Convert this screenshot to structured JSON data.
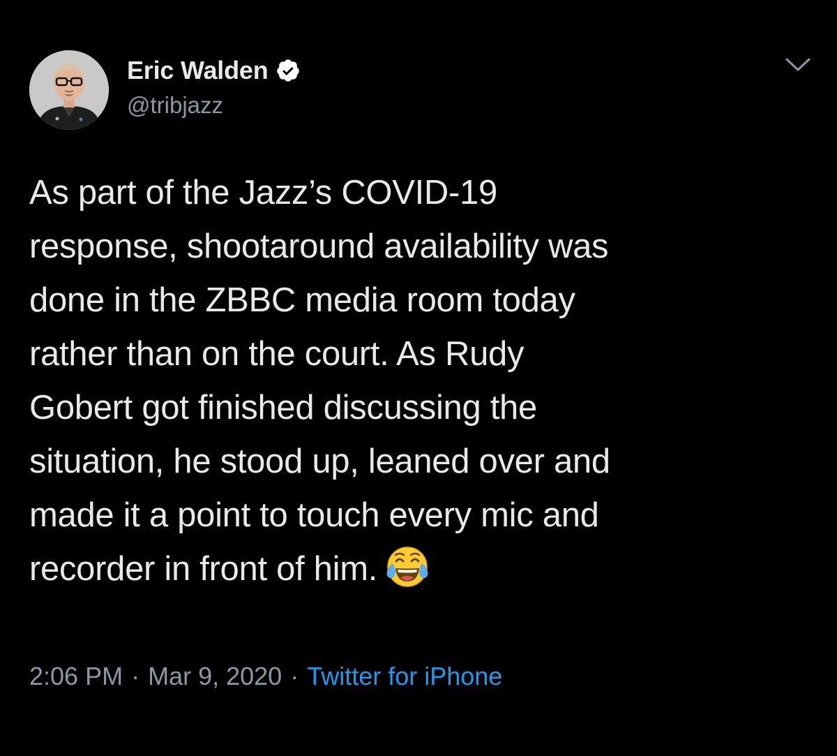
{
  "author": {
    "display_name": "Eric Walden",
    "handle": "@tribjazz",
    "verified": true,
    "verified_color": "#ffffff"
  },
  "tweet": {
    "lines": [
      "As part of the Jazz’s COVID-19",
      "response, shootaround availability was",
      "done in the ZBBC media room today",
      "rather than on the court. As Rudy",
      "Gobert got finished discussing the",
      "situation, he stood up, leaned over and",
      "made it a point to touch every mic and",
      "recorder in front of him."
    ],
    "emoji": "face-with-tears-of-joy"
  },
  "meta": {
    "time": "2:06 PM",
    "separator": "·",
    "date": "Mar 9, 2020",
    "source": "Twitter for iPhone"
  },
  "icons": {
    "menu": "chevron-down-icon",
    "verified": "verified-badge-icon",
    "avatar": "avatar"
  },
  "colors": {
    "background": "#000000",
    "text": "#e7e9ea",
    "secondary": "#8b98a5",
    "link": "#1d9bf0"
  }
}
